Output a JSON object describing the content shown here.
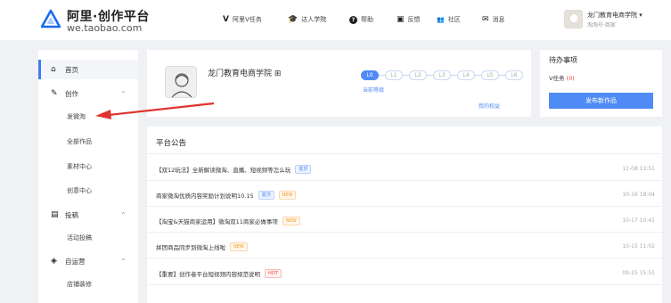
{
  "header": {
    "brand_title": "阿里·创作平台",
    "brand_sub": "we.taobao.com",
    "nav": [
      {
        "icon": "v-icon",
        "glyph": "V",
        "label": "阿里V任务"
      },
      {
        "icon": "graduation-cap-icon",
        "glyph": "🎓",
        "label": "达人学院"
      },
      {
        "icon": "help-icon",
        "glyph": "?",
        "label": "帮助"
      },
      {
        "icon": "feedback-icon",
        "glyph": "▣",
        "label": "反馈"
      },
      {
        "icon": "community-icon",
        "glyph": "👥",
        "label": "社区"
      },
      {
        "icon": "mail-icon",
        "glyph": "✉",
        "label": "消息"
      }
    ],
    "user_name": "龙门教育电商学院 ▾",
    "user_sub": "淘淘号·商家"
  },
  "sidebar": {
    "items": [
      {
        "label": "首页",
        "icon": "home-icon",
        "glyph": "⌂"
      },
      {
        "label": "创作",
        "icon": "pencil-icon",
        "glyph": "✎",
        "caret": "^"
      },
      {
        "label": "投稿",
        "icon": "document-icon",
        "glyph": "▤",
        "caret": "^"
      },
      {
        "label": "自运营",
        "icon": "cube-icon",
        "glyph": "◈",
        "caret": "^"
      }
    ],
    "subitems": [
      "发微淘",
      "全部作品",
      "素材中心",
      "创意中心",
      "活动投稿",
      "店铺装修"
    ]
  },
  "profile": {
    "name": "龙门教育电商学院 ⊞",
    "levels": [
      "L0",
      "L1",
      "L2",
      "L3",
      "L4",
      "L5",
      "L6"
    ],
    "current_level": "当前等级",
    "my_rights": "我的权益"
  },
  "todo": {
    "title": "待办事项",
    "count_label": "V任务",
    "count_value": "(0)",
    "publish_label": "发布新作品"
  },
  "announcements": {
    "title": "平台公告",
    "rows": [
      {
        "text": "【双12玩法】全新解读微淘、直播、短视频等怎么玩",
        "tag": "置顶",
        "tag_color": "blue",
        "time": "11-08 13:51"
      },
      {
        "text": "商家微淘优质内容奖励计划说明10.15",
        "tag": "置顶",
        "tag_color": "blue",
        "tag2": "NEW",
        "time": "10-16 18:04"
      },
      {
        "text": "【淘宝&天猫商家运用】微淘双11商家必做事项",
        "tag": "NEW",
        "tag_color": "orange",
        "time": "10-17 10:41"
      },
      {
        "text": "拼团商品同步到微淘上线啦",
        "tag": "NEW",
        "tag_color": "orange",
        "time": "10-15 11:02"
      },
      {
        "text": "【重要】创作者平台短视频内容规范说明",
        "tag": "HOT",
        "tag_color": "red",
        "time": "09-25 15:51"
      }
    ]
  },
  "colors": {
    "accent": "#4e8bf5",
    "arrow": "#e0332f",
    "hot": "#f0433c",
    "new": "#f59a23"
  }
}
